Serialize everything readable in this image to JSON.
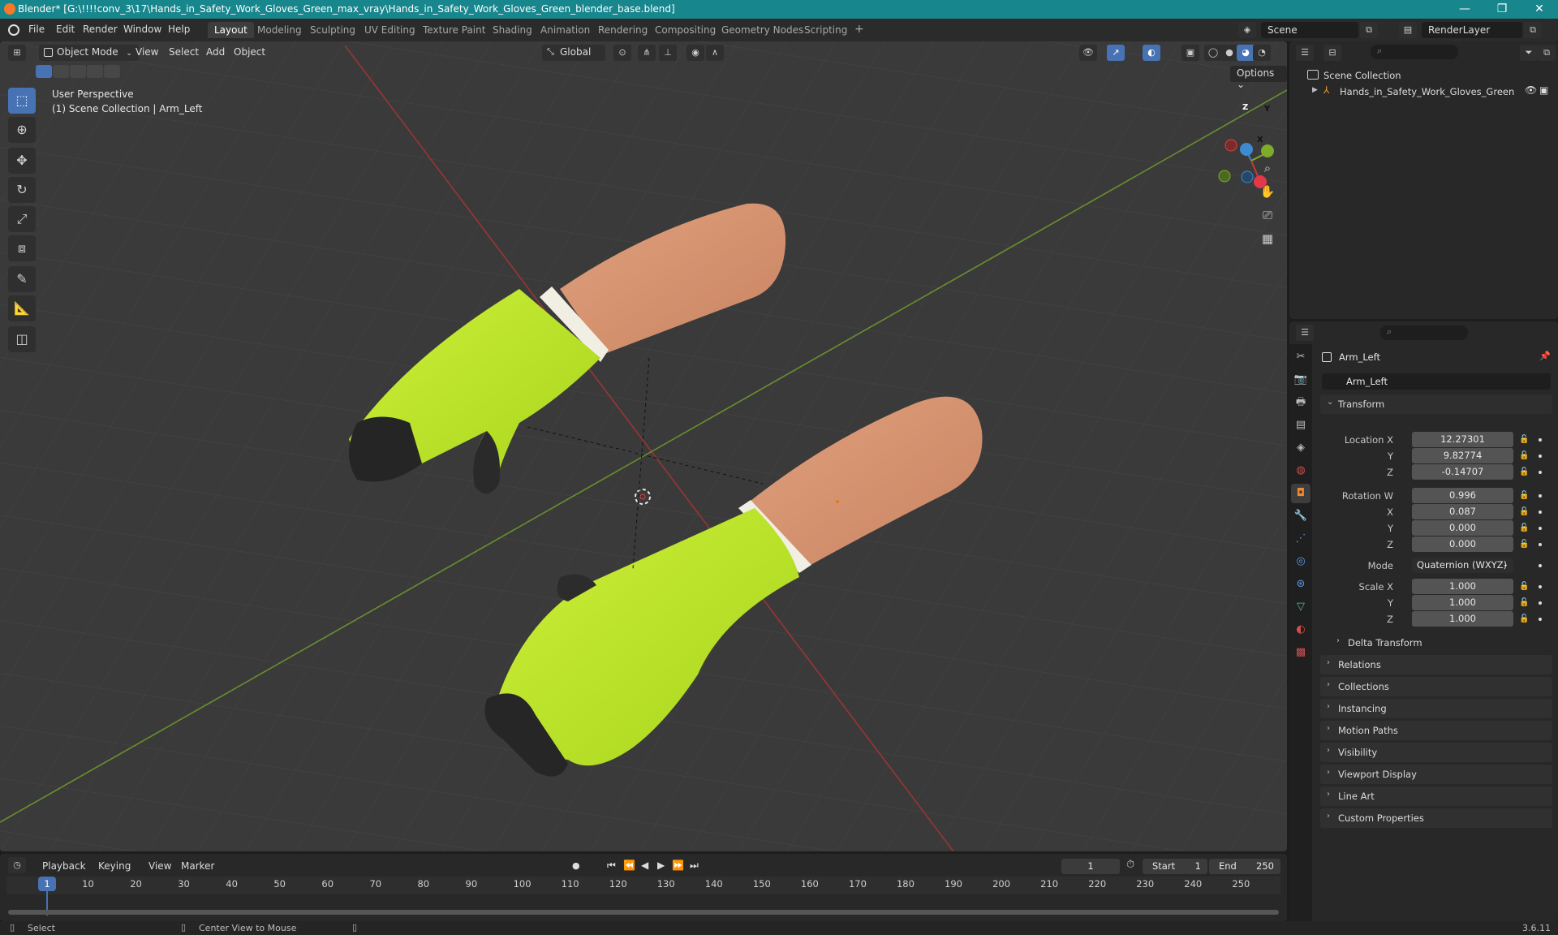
{
  "window": {
    "title": "Blender* [G:\\!!!!conv_3\\17\\Hands_in_Safety_Work_Gloves_Green_max_vray\\Hands_in_Safety_Work_Gloves_Green_blender_base.blend]",
    "minimize": "—",
    "maximize": "❐",
    "close": "✕"
  },
  "menu": [
    "File",
    "Edit",
    "Render",
    "Window",
    "Help"
  ],
  "workspaces": [
    {
      "label": "Layout",
      "active": true
    },
    {
      "label": "Modeling"
    },
    {
      "label": "Sculpting"
    },
    {
      "label": "UV Editing"
    },
    {
      "label": "Texture Paint"
    },
    {
      "label": "Shading"
    },
    {
      "label": "Animation"
    },
    {
      "label": "Rendering"
    },
    {
      "label": "Compositing"
    },
    {
      "label": "Geometry Nodes"
    },
    {
      "label": "Scripting"
    }
  ],
  "add_workspace": "+",
  "scene": {
    "name": "Scene",
    "render_layer": "RenderLayer"
  },
  "viewport": {
    "mode": "Object Mode",
    "menus": [
      "View",
      "Select",
      "Add",
      "Object"
    ],
    "transform_orientation": "Global",
    "options": "Options",
    "perspective": "User Perspective",
    "collection_info": "(1) Scene Collection | Arm_Left",
    "gizmo": {
      "x": "X",
      "y": "Y",
      "z": "Z"
    }
  },
  "outliner": {
    "root": "Scene Collection",
    "items": [
      {
        "name": "Hands_in_Safety_Work_Gloves_Green"
      }
    ]
  },
  "properties": {
    "object_name": "Arm_Left",
    "object_datablock": "Arm_Left",
    "transform_label": "Transform",
    "location": {
      "label": "Location X",
      "x": "12.27301",
      "y": "9.82774",
      "z": "-0.14707"
    },
    "rotation": {
      "label": "Rotation W",
      "w": "0.996",
      "x": "0.087",
      "y": "0.000",
      "z": "0.000"
    },
    "mode_label": "Mode",
    "mode_value": "Quaternion (WXYZ)",
    "scale": {
      "label": "Scale X",
      "x": "1.000",
      "y": "1.000",
      "z": "1.000"
    },
    "axis_labels": {
      "y": "Y",
      "z": "Z",
      "x": "X"
    },
    "delta": "Delta Transform",
    "panels": [
      "Relations",
      "Collections",
      "Instancing",
      "Motion Paths",
      "Visibility",
      "Viewport Display",
      "Line Art",
      "Custom Properties"
    ]
  },
  "timeline": {
    "menus": [
      "Playback",
      "Keying",
      "View",
      "Marker"
    ],
    "current_frame": "1",
    "start_label": "Start",
    "start": "1",
    "end_label": "End",
    "end": "250",
    "ticks": [
      "1",
      "10",
      "20",
      "30",
      "40",
      "50",
      "60",
      "70",
      "80",
      "90",
      "100",
      "110",
      "120",
      "130",
      "140",
      "150",
      "160",
      "170",
      "180",
      "190",
      "200",
      "210",
      "220",
      "230",
      "240",
      "250"
    ]
  },
  "status": {
    "select": "Select",
    "center": "Center View to Mouse",
    "version": "3.6.11"
  }
}
